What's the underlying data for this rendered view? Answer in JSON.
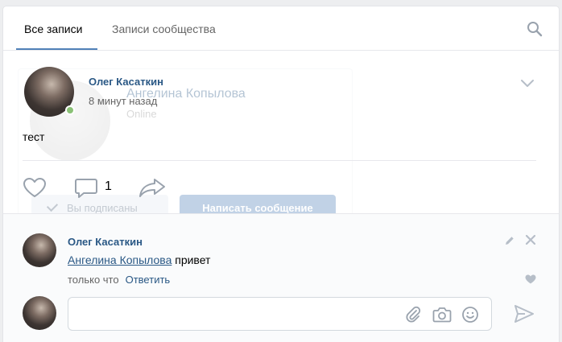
{
  "tabs": [
    {
      "label": "Все записи",
      "active": true
    },
    {
      "label": "Записи сообщества",
      "active": false
    }
  ],
  "ghost_popup": {
    "name": "Ангелина Копылова",
    "status": "Online",
    "subscribed_label": "Вы подписаны",
    "message_button": "Написать сообщение"
  },
  "post": {
    "author": "Олег Касаткин",
    "time": "8 минут назад",
    "text": "тест",
    "comment_count": "1"
  },
  "comment": {
    "author": "Олег Касаткин",
    "mention": "Ангелина Копылова",
    "text": " привет",
    "time": "только что",
    "reply_label": "Ответить"
  },
  "reply_box": {
    "placeholder": ""
  },
  "colors": {
    "accent": "#5181b8",
    "link": "#2a5885",
    "online": "#8ac176",
    "icon": "#99a2ad"
  },
  "icons": [
    "search-icon",
    "chevron-down-icon",
    "like-icon",
    "comment-icon",
    "share-icon",
    "pencil-icon",
    "close-icon",
    "heart-small-icon",
    "attach-icon",
    "camera-icon",
    "smile-icon",
    "send-icon"
  ]
}
